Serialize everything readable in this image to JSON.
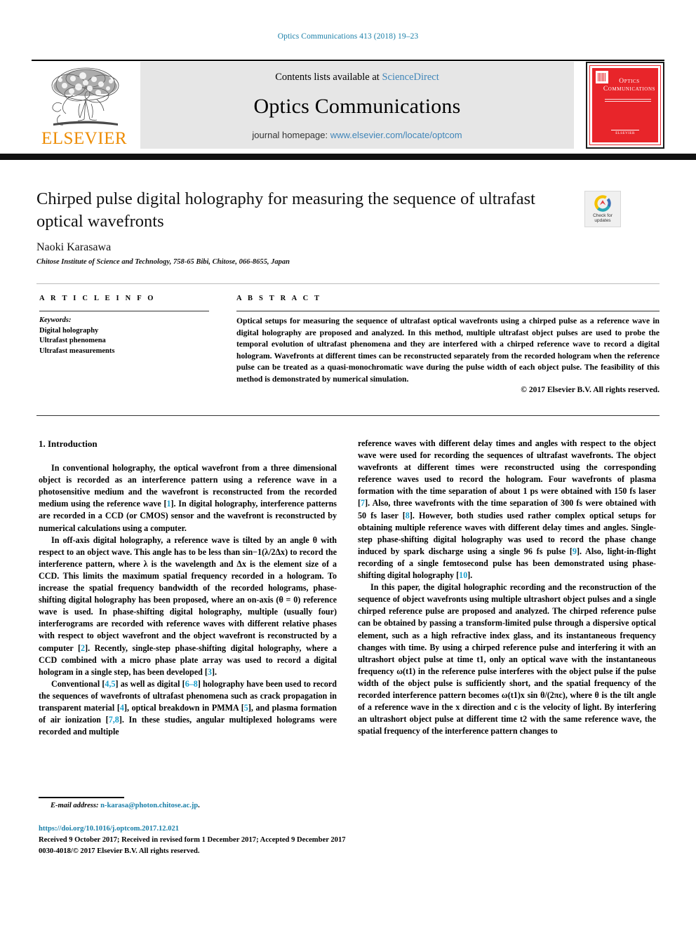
{
  "running_head": "Optics Communications 413 (2018) 19–23",
  "masthead": {
    "publisher_name": "ELSEVIER",
    "contents_prefix": "Contents lists available at ",
    "contents_link": "ScienceDirect",
    "journal_name": "Optics Communications",
    "homepage_prefix": "journal homepage: ",
    "homepage_link": "www.elsevier.com/locate/optcom",
    "cover_title": "Optics Communications",
    "cover_footer_line1": "ELSEVIER"
  },
  "article": {
    "title": "Chirped pulse digital holography for measuring the sequence of ultrafast optical wavefronts",
    "author": "Naoki Karasawa",
    "affiliation": "Chitose Institute of Science and Technology, 758-65 Bibi, Chitose, 066-8655, Japan",
    "crossmark_label_line1": "Check for",
    "crossmark_label_line2": "updates"
  },
  "info": {
    "heading": "A R T I C L E    I N F O",
    "keywords_label": "Keywords:",
    "keywords": [
      "Digital holography",
      "Ultrafast phenomena",
      "Ultrafast measurements"
    ]
  },
  "abstract": {
    "heading": "A B S T R A C T",
    "text": "Optical setups for measuring the sequence of ultrafast optical wavefronts using a chirped pulse as a reference wave in digital holography are proposed and analyzed. In this method, multiple ultrafast object pulses are used to probe the temporal evolution of ultrafast phenomena and they are interfered with a chirped reference wave to record a digital hologram. Wavefronts at different times can be reconstructed separately from the recorded hologram when the reference pulse can be treated as a quasi-monochromatic wave during the pulse width of each object pulse. The feasibility of this method is demonstrated by numerical simulation.",
    "copyright": "© 2017 Elsevier B.V. All rights reserved."
  },
  "body": {
    "section_title": "1.  Introduction",
    "left_paragraphs": [
      "In conventional holography, the optical wavefront from a three dimensional object is recorded as an interference pattern using a reference wave in a photosensitive medium and the wavefront is reconstructed from the recorded medium using the reference wave [1]. In digital holography, interference patterns are recorded in a CCD (or CMOS) sensor and the wavefront is reconstructed by numerical calculations using a computer.",
      "In off-axis digital holography, a reference wave is tilted by an angle θ with respect to an object wave. This angle has to be less than sin−1(λ/2Δx) to record the interference pattern, where λ is the wavelength and Δx is the element size of a CCD. This limits the maximum spatial frequency recorded in a hologram. To increase the spatial frequency bandwidth of the recorded holograms, phase-shifting digital holography has been proposed, where an on-axis (θ = 0) reference wave is used. In phase-shifting digital holography, multiple (usually four) interferograms are recorded with reference waves with different relative phases with respect to object wavefront and the object wavefront is reconstructed by a computer [2]. Recently, single-step phase-shifting digital holography, where a CCD combined with a micro phase plate array was used to record a digital hologram in a single step, has been developed [3].",
      "Conventional [4,5] as well as digital [6–8] holography have been used to record the sequences of wavefronts of ultrafast phenomena such as crack propagation in transparent material [4], optical breakdown in PMMA [5], and plasma formation of air ionization [7,8]. In these studies, angular multiplexed holograms were recorded and multiple"
    ],
    "right_paragraphs": [
      "reference waves with different delay times and angles with respect to the object wave were used for recording the sequences of ultrafast wavefronts. The object wavefronts at different times were reconstructed using the corresponding reference waves used to record the hologram. Four wavefronts of plasma formation with the time separation of about 1 ps were obtained with 150 fs laser [7]. Also, three wavefronts with the time separation of 300 fs were obtained with 50 fs laser [8]. However, both studies used rather complex optical setups for obtaining multiple reference waves with different delay times and angles. Single-step phase-shifting digital holography was used to record the phase change induced by spark discharge using a single 96 fs pulse [9]. Also, light-in-flight recording of a single femtosecond pulse has been demonstrated using phase-shifting digital holography [10].",
      "In this paper, the digital holographic recording and the reconstruction of the sequence of object wavefronts using multiple ultrashort object pulses and a single chirped reference pulse are proposed and analyzed. The chirped reference pulse can be obtained by passing a transform-limited pulse through a dispersive optical element, such as a high refractive index glass, and its instantaneous frequency changes with time. By using a chirped reference pulse and interfering it with an ultrashort object pulse at time t1, only an optical wave with the instantaneous frequency ω(t1) in the reference pulse interferes with the object pulse if the pulse width of the object pulse is sufficiently short, and the spatial frequency of the recorded interference pattern becomes ω(t1)x sin θ/(2πc), where θ is the tilt angle of a reference wave in the x direction and c is the velocity of light. By interfering an ultrashort object pulse at different time t2 with the same reference wave, the spatial frequency of the interference pattern changes to"
    ]
  },
  "footer": {
    "email_label": "E-mail address:",
    "email": "n-karasa@photon.chitose.ac.jp",
    "email_trailing": ".",
    "doi": "https://doi.org/10.1016/j.optcom.2017.12.021",
    "history": "Received 9 October 2017; Received in revised form 1 December 2017; Accepted 9 December 2017",
    "issn": "0030-4018/© 2017 Elsevier B.V. All rights reserved."
  },
  "colors": {
    "link": "#3f85b8",
    "running_head": "#1a7fa8",
    "reference": "#1a9ecb",
    "elsevier_orange": "#ED8B00",
    "cover_red": "#e8252a"
  }
}
